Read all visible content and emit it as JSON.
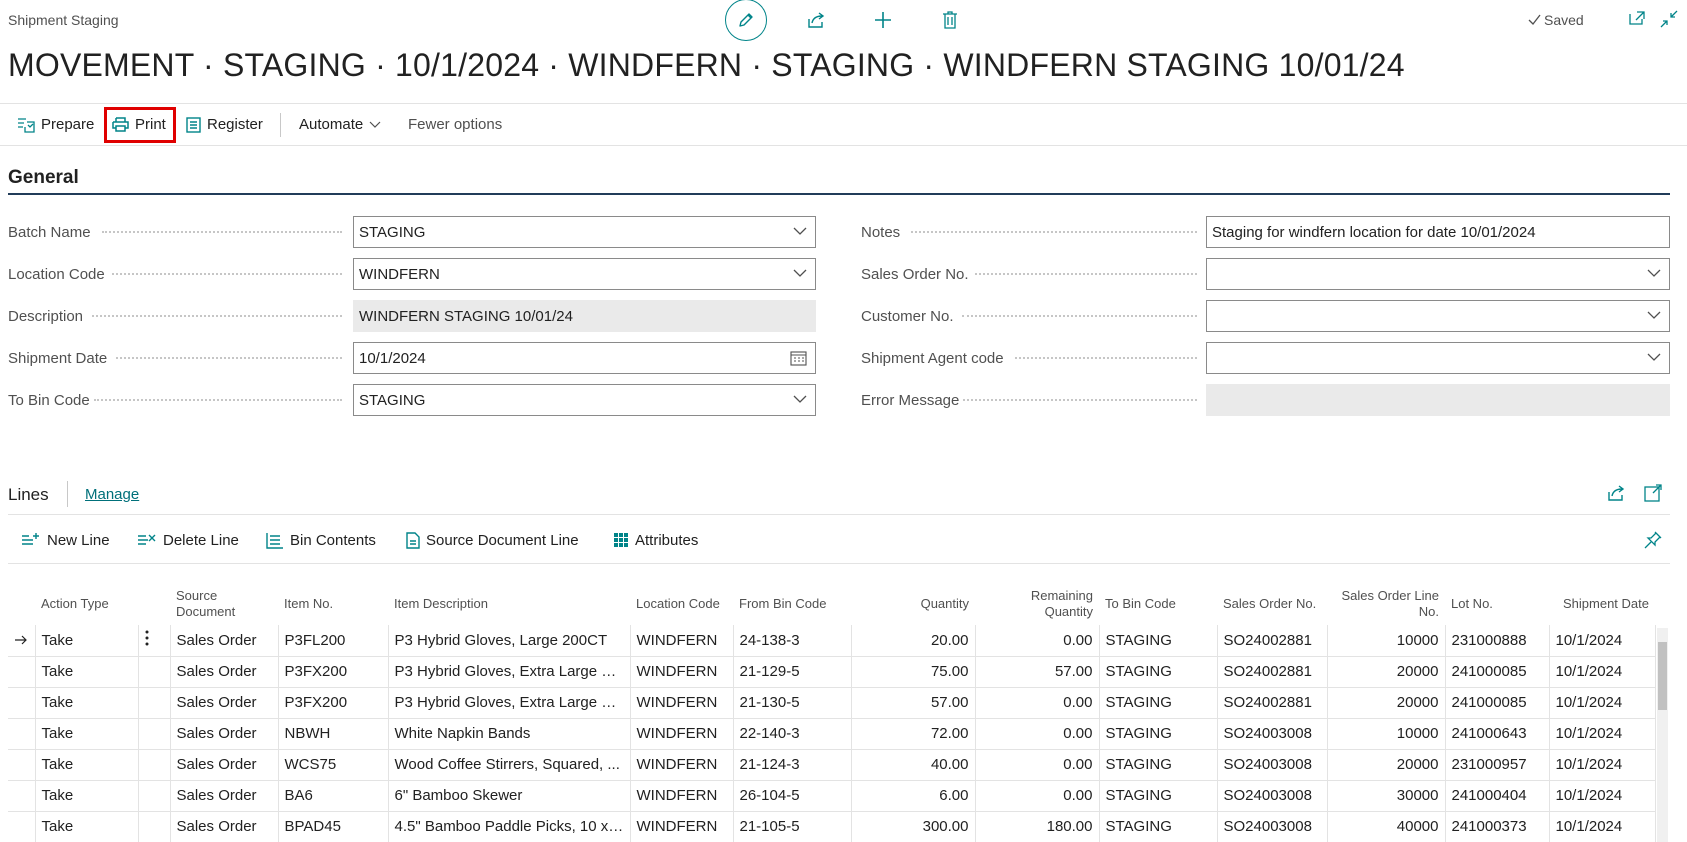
{
  "header": {
    "caption": "Shipment Staging",
    "saved_label": "Saved",
    "title": "MOVEMENT · STAGING · 10/1/2024 · WINDFERN · STAGING · WINDFERN STAGING 10/01/24"
  },
  "toolbar": {
    "prepare": "Prepare",
    "print": "Print",
    "register": "Register",
    "automate": "Automate",
    "fewer_options": "Fewer options"
  },
  "general": {
    "heading": "General",
    "left_fields": [
      {
        "label": "Batch Name",
        "value": "STAGING"
      },
      {
        "label": "Location Code",
        "value": "WINDFERN"
      },
      {
        "label": "Description",
        "value": "WINDFERN STAGING 10/01/24"
      },
      {
        "label": "Shipment Date",
        "value": "10/1/2024"
      },
      {
        "label": "To Bin Code",
        "value": "STAGING"
      }
    ],
    "right_fields": [
      {
        "label": "Notes",
        "value": "Staging for windfern location for date 10/01/2024"
      },
      {
        "label": "Sales Order No.",
        "value": ""
      },
      {
        "label": "Customer No.",
        "value": ""
      },
      {
        "label": "Shipment Agent code",
        "value": ""
      },
      {
        "label": "Error Message",
        "value": ""
      }
    ]
  },
  "lines": {
    "heading": "Lines",
    "manage": "Manage",
    "actions": {
      "new_line": "New Line",
      "delete_line": "Delete Line",
      "bin_contents": "Bin Contents",
      "source_document_line": "Source Document Line",
      "attributes": "Attributes"
    },
    "columns": {
      "action_type": "Action Type",
      "source_document": "Source Document",
      "item_no": "Item No.",
      "item_description": "Item Description",
      "location_code": "Location Code",
      "from_bin_code": "From Bin Code",
      "quantity": "Quantity",
      "remaining_quantity": "Remaining Quantity",
      "to_bin_code": "To Bin Code",
      "sales_order_no": "Sales Order No.",
      "sales_order_line_no": "Sales Order Line No.",
      "lot_no": "Lot No.",
      "shipment_date": "Shipment Date"
    },
    "rows": [
      {
        "action_type": "Take",
        "source_document": "Sales Order",
        "item_no": "P3FL200",
        "item_description": "P3 Hybrid Gloves, Large 200CT",
        "location_code": "WINDFERN",
        "from_bin_code": "24-138-3",
        "quantity": "20.00",
        "remaining_quantity": "0.00",
        "to_bin_code": "STAGING",
        "sales_order_no": "SO24002881",
        "sales_order_line_no": "10000",
        "lot_no": "231000888",
        "shipment_date": "10/1/2024"
      },
      {
        "action_type": "Take",
        "source_document": "Sales Order",
        "item_no": "P3FX200",
        "item_description": "P3 Hybrid Gloves, Extra Large 20...",
        "location_code": "WINDFERN",
        "from_bin_code": "21-129-5",
        "quantity": "75.00",
        "remaining_quantity": "57.00",
        "to_bin_code": "STAGING",
        "sales_order_no": "SO24002881",
        "sales_order_line_no": "20000",
        "lot_no": "241000085",
        "shipment_date": "10/1/2024"
      },
      {
        "action_type": "Take",
        "source_document": "Sales Order",
        "item_no": "P3FX200",
        "item_description": "P3 Hybrid Gloves, Extra Large 20...",
        "location_code": "WINDFERN",
        "from_bin_code": "21-130-5",
        "quantity": "57.00",
        "remaining_quantity": "0.00",
        "to_bin_code": "STAGING",
        "sales_order_no": "SO24002881",
        "sales_order_line_no": "20000",
        "lot_no": "241000085",
        "shipment_date": "10/1/2024"
      },
      {
        "action_type": "Take",
        "source_document": "Sales Order",
        "item_no": "NBWH",
        "item_description": "White Napkin Bands",
        "location_code": "WINDFERN",
        "from_bin_code": "22-140-3",
        "quantity": "72.00",
        "remaining_quantity": "0.00",
        "to_bin_code": "STAGING",
        "sales_order_no": "SO24003008",
        "sales_order_line_no": "10000",
        "lot_no": "241000643",
        "shipment_date": "10/1/2024"
      },
      {
        "action_type": "Take",
        "source_document": "Sales Order",
        "item_no": "WCS75",
        "item_description": "Wood Coffee Stirrers, Squared, ...",
        "location_code": "WINDFERN",
        "from_bin_code": "21-124-3",
        "quantity": "40.00",
        "remaining_quantity": "0.00",
        "to_bin_code": "STAGING",
        "sales_order_no": "SO24003008",
        "sales_order_line_no": "20000",
        "lot_no": "231000957",
        "shipment_date": "10/1/2024"
      },
      {
        "action_type": "Take",
        "source_document": "Sales Order",
        "item_no": "BA6",
        "item_description": "6\" Bamboo Skewer",
        "location_code": "WINDFERN",
        "from_bin_code": "26-104-5",
        "quantity": "6.00",
        "remaining_quantity": "0.00",
        "to_bin_code": "STAGING",
        "sales_order_no": "SO24003008",
        "sales_order_line_no": "30000",
        "lot_no": "241000404",
        "shipment_date": "10/1/2024"
      },
      {
        "action_type": "Take",
        "source_document": "Sales Order",
        "item_no": "BPAD45",
        "item_description": "4.5\" Bamboo Paddle Picks, 10 x ...",
        "location_code": "WINDFERN",
        "from_bin_code": "21-105-5",
        "quantity": "300.00",
        "remaining_quantity": "180.00",
        "to_bin_code": "STAGING",
        "sales_order_no": "SO24003008",
        "sales_order_line_no": "40000",
        "lot_no": "241000373",
        "shipment_date": "10/1/2024"
      }
    ]
  },
  "colors": {
    "accent": "#008489",
    "highlight": "#e00000",
    "heading_rule": "#213c59"
  }
}
